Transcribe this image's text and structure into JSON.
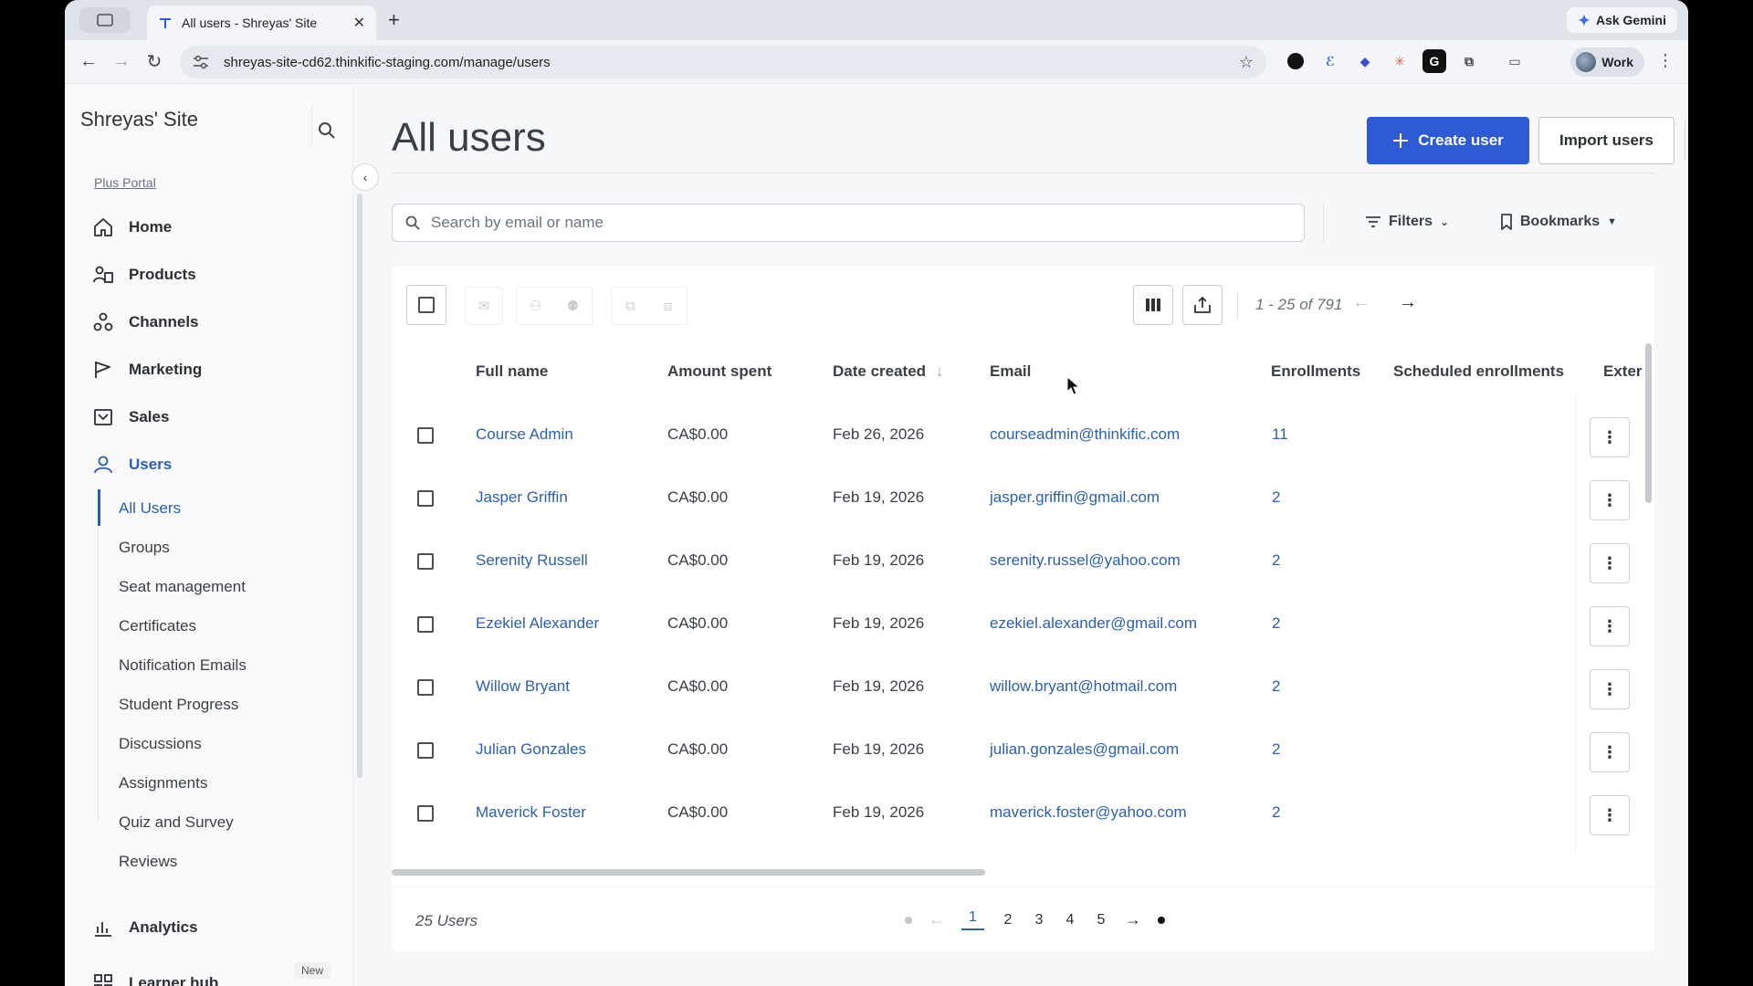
{
  "browser": {
    "tab_title": "All users - Shreyas' Site",
    "tab_close": "✕",
    "new_tab": "+",
    "gemini_label": "Ask Gemini",
    "url": "shreyas-site-cd62.thinkific-staging.com/manage/users",
    "profile_label": "Work"
  },
  "sidebar": {
    "site_name": "Shreyas' Site",
    "plus_portal": "Plus Portal",
    "nav": [
      {
        "label": "Home",
        "icon": "home-icon"
      },
      {
        "label": "Products",
        "icon": "products-icon"
      },
      {
        "label": "Channels",
        "icon": "channels-icon"
      },
      {
        "label": "Marketing",
        "icon": "marketing-icon"
      },
      {
        "label": "Sales",
        "icon": "sales-icon"
      },
      {
        "label": "Users",
        "icon": "user-icon"
      },
      {
        "label": "Analytics",
        "icon": "analytics-icon"
      },
      {
        "label": "Learner hub",
        "icon": "grid-icon"
      }
    ],
    "sub_items": [
      "All Users",
      "Groups",
      "Seat management",
      "Certificates",
      "Notification Emails",
      "Student Progress",
      "Discussions",
      "Assignments",
      "Quiz and Survey",
      "Reviews"
    ],
    "new_badge": "New"
  },
  "main": {
    "title": "All users",
    "create_user": "Create user",
    "import_users": "Import users",
    "search_placeholder": "Search by email or name",
    "filters_label": "Filters",
    "bookmarks_label": "Bookmarks",
    "range_label": "1 - 25 of 791"
  },
  "table": {
    "headers": [
      "Full name",
      "Amount spent",
      "Date created",
      "Email",
      "Enrollments",
      "Scheduled enrollments",
      "Exter"
    ],
    "rows": [
      {
        "name": "Course Admin",
        "amount": "CA$0.00",
        "date": "Feb 26, 2026",
        "email": "courseadmin@thinkific.com",
        "enrollments": "11"
      },
      {
        "name": "Jasper Griffin",
        "amount": "CA$0.00",
        "date": "Feb 19, 2026",
        "email": "jasper.griffin@gmail.com",
        "enrollments": "2"
      },
      {
        "name": "Serenity Russell",
        "amount": "CA$0.00",
        "date": "Feb 19, 2026",
        "email": "serenity.russel@yahoo.com",
        "enrollments": "2"
      },
      {
        "name": "Ezekiel Alexander",
        "amount": "CA$0.00",
        "date": "Feb 19, 2026",
        "email": "ezekiel.alexander@gmail.com",
        "enrollments": "2"
      },
      {
        "name": "Willow Bryant",
        "amount": "CA$0.00",
        "date": "Feb 19, 2026",
        "email": "willow.bryant@hotmail.com",
        "enrollments": "2"
      },
      {
        "name": "Julian Gonzales",
        "amount": "CA$0.00",
        "date": "Feb 19, 2026",
        "email": "julian.gonzales@gmail.com",
        "enrollments": "2"
      },
      {
        "name": "Maverick Foster",
        "amount": "CA$0.00",
        "date": "Feb 19, 2026",
        "email": "maverick.foster@yahoo.com",
        "enrollments": "2"
      }
    ],
    "users_count": "25 Users",
    "pages": [
      "1",
      "2",
      "3",
      "4",
      "5"
    ]
  },
  "colors": {
    "accent": "#2e5bd5",
    "link": "#2b5fb4"
  }
}
